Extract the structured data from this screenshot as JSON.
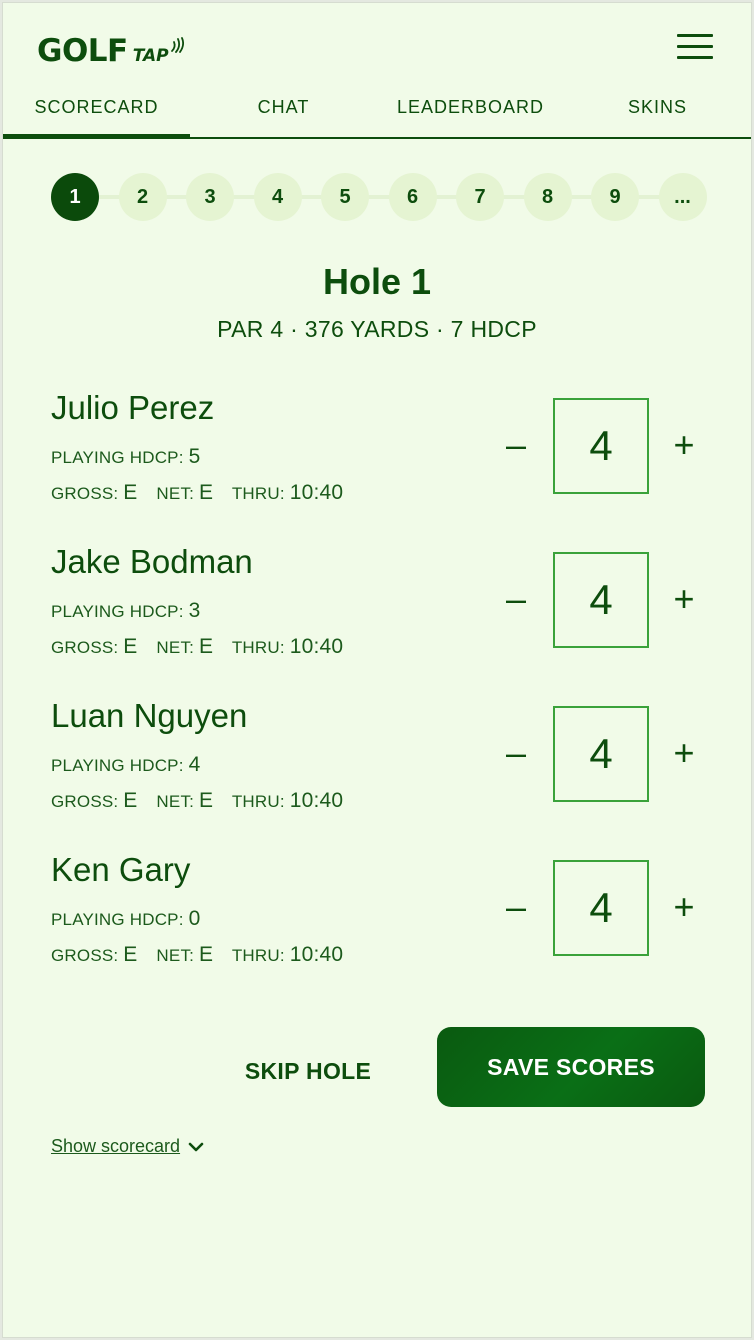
{
  "brand": {
    "logo_main": "GOLF",
    "logo_sub": "TAP"
  },
  "tabs": [
    {
      "label": "SCORECARD",
      "active": true
    },
    {
      "label": "CHAT",
      "active": false
    },
    {
      "label": "LEADERBOARD",
      "active": false
    },
    {
      "label": "SKINS",
      "active": false
    }
  ],
  "holes": [
    "1",
    "2",
    "3",
    "4",
    "5",
    "6",
    "7",
    "8",
    "9",
    "..."
  ],
  "current_hole_index": 0,
  "hole": {
    "title": "Hole 1",
    "meta": "PAR 4 · 376 YARDS · 7 HDCP"
  },
  "labels": {
    "playing_hdcp": "PLAYING HDCP:",
    "gross": "GROSS:",
    "net": "NET:",
    "thru": "THRU:",
    "minus": "–",
    "plus": "+"
  },
  "players": [
    {
      "name": "Julio Perez",
      "playing_hdcp": "5",
      "gross": "E",
      "net": "E",
      "thru": "10:40",
      "score": "4"
    },
    {
      "name": "Jake Bodman",
      "playing_hdcp": "3",
      "gross": "E",
      "net": "E",
      "thru": "10:40",
      "score": "4"
    },
    {
      "name": "Luan Nguyen",
      "playing_hdcp": "4",
      "gross": "E",
      "net": "E",
      "thru": "10:40",
      "score": "4"
    },
    {
      "name": "Ken Gary",
      "playing_hdcp": "0",
      "gross": "E",
      "net": "E",
      "thru": "10:40",
      "score": "4"
    }
  ],
  "actions": {
    "skip": "SKIP HOLE",
    "save": "SAVE SCORES",
    "show_scorecard": "Show scorecard"
  },
  "colors": {
    "primary": "#0d4d0d",
    "background": "#f1fbe8",
    "hole_inactive": "#e5f4d2",
    "score_border": "#3aa23a"
  },
  "icons": {
    "menu": "hamburger-menu-icon",
    "show_scorecard": "chevron-down-icon",
    "logo": "wireless-waves-icon"
  }
}
